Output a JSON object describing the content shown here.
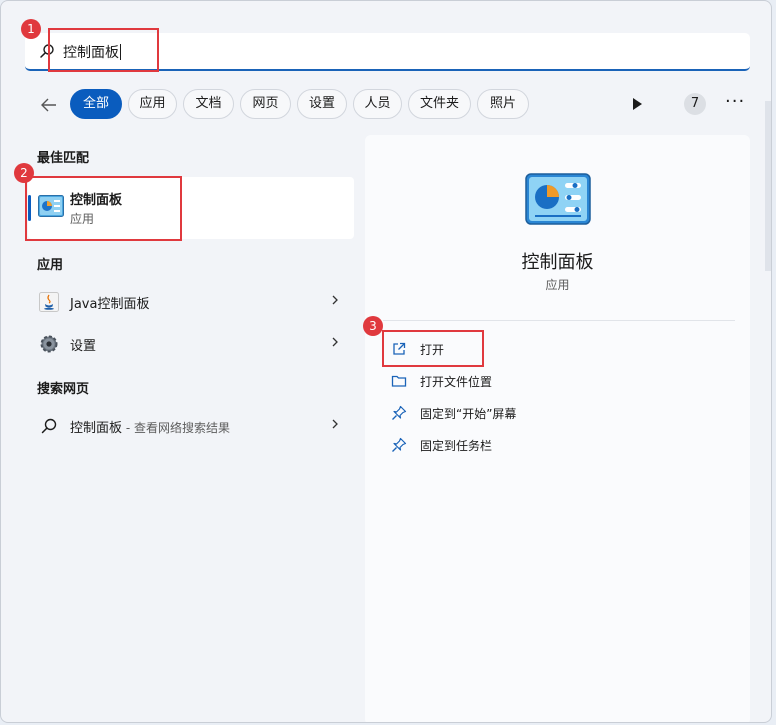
{
  "search": {
    "query": "控制面板"
  },
  "filters": {
    "chips": [
      "全部",
      "应用",
      "文档",
      "网页",
      "设置",
      "人员",
      "文件夹",
      "照片"
    ],
    "count": "7",
    "more": "···"
  },
  "results": {
    "best_match_title": "最佳匹配",
    "best_match": {
      "title": "控制面板",
      "subtitle": "应用"
    },
    "apps_title": "应用",
    "apps": [
      {
        "label": "Java控制面板",
        "icon": "java-icon"
      },
      {
        "label": "设置",
        "icon": "gear-icon"
      }
    ],
    "web_title": "搜索网页",
    "web": {
      "label": "控制面板",
      "suffix": " - 查看网络搜索结果"
    }
  },
  "detail": {
    "title": "控制面板",
    "subtitle": "应用",
    "actions": [
      {
        "label": "打开",
        "icon": "open-external-icon"
      },
      {
        "label": "打开文件位置",
        "icon": "folder-icon"
      },
      {
        "label": "固定到“开始”屏幕",
        "icon": "pin-icon"
      },
      {
        "label": "固定到任务栏",
        "icon": "pin-icon"
      }
    ]
  },
  "annotations": [
    "1",
    "2",
    "3"
  ],
  "colors": {
    "accent": "#0a5cbe",
    "annotation": "#e0393e"
  }
}
